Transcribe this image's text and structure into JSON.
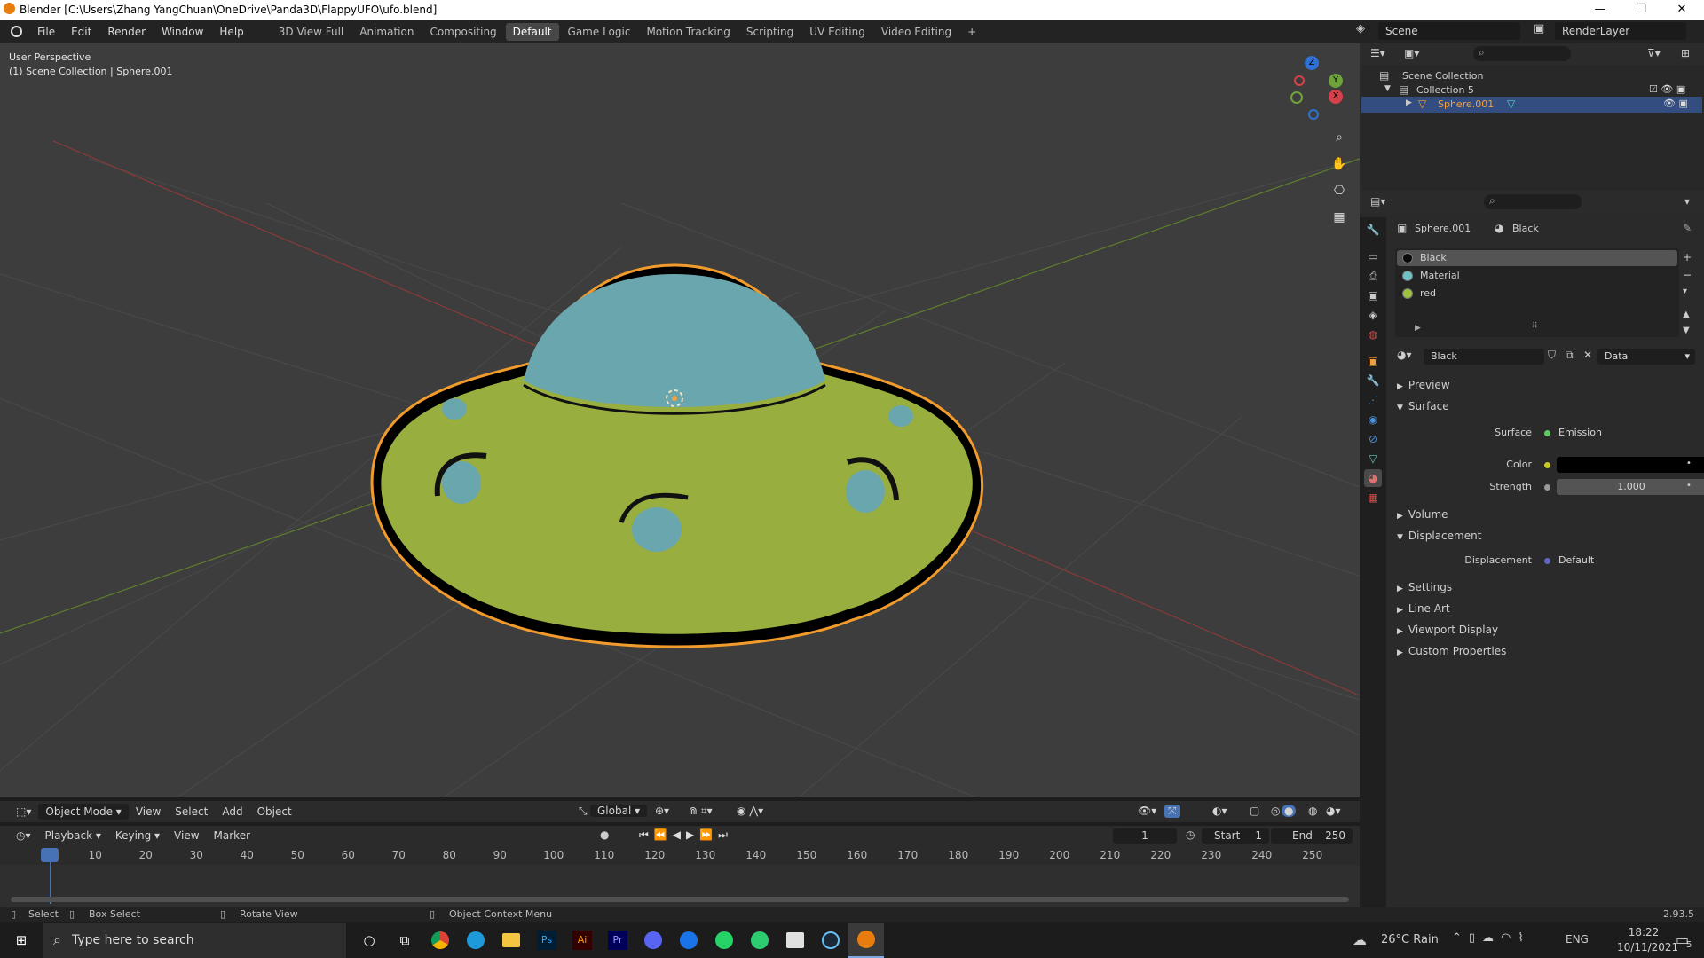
{
  "window": {
    "title": "Blender [C:\\Users\\Zhang YangChuan\\OneDrive\\Panda3D\\FlappyUFO\\ufo.blend]",
    "minimize": "—",
    "restore": "❐",
    "close": "✕"
  },
  "menu": [
    "File",
    "Edit",
    "Render",
    "Window",
    "Help"
  ],
  "workspaces": [
    "3D View Full",
    "Animation",
    "Compositing",
    "Default",
    "Game Logic",
    "Motion Tracking",
    "Scripting",
    "UV Editing",
    "Video Editing"
  ],
  "active_workspace": "Default",
  "add_workspace": "+",
  "scene": {
    "name": "Scene",
    "render_layer": "RenderLayer"
  },
  "viewport": {
    "perspective": "User Perspective",
    "collection_label": "(1) Scene Collection | Sphere.001",
    "gizmo": {
      "z": "Z",
      "y": "Y",
      "x": "X"
    },
    "header": {
      "mode": "Object Mode",
      "menus": [
        "View",
        "Select",
        "Add",
        "Object"
      ],
      "orientation": "Global"
    }
  },
  "timeline": {
    "menus": [
      "Playback",
      "Keying",
      "View",
      "Marker"
    ],
    "current_frame": "1",
    "start_label": "Start",
    "start": "1",
    "end_label": "End",
    "end": "250",
    "ruler": [
      "1",
      "10",
      "20",
      "30",
      "40",
      "50",
      "60",
      "70",
      "80",
      "90",
      "100",
      "110",
      "120",
      "130",
      "140",
      "150",
      "160",
      "170",
      "180",
      "190",
      "200",
      "210",
      "220",
      "230",
      "240",
      "250"
    ]
  },
  "outliner": {
    "root": "Scene Collection",
    "collection": "Collection 5",
    "object": "Sphere.001"
  },
  "properties": {
    "object": "Sphere.001",
    "material": "Black",
    "slots": [
      {
        "name": "Black",
        "color": "#0a0a0a"
      },
      {
        "name": "Material",
        "color": "#6fc3c7"
      },
      {
        "name": "red",
        "color": "#9bc43c"
      }
    ],
    "material_field": "Black",
    "link": "Data",
    "panels": {
      "preview": "Preview",
      "surface": "Surface",
      "surface_label": "Surface",
      "surface_value": "Emission",
      "color_label": "Color",
      "strength_label": "Strength",
      "strength_value": "1.000",
      "volume": "Volume",
      "displacement": "Displacement",
      "displacement_label": "Displacement",
      "displacement_value": "Default",
      "settings": "Settings",
      "line_art": "Line Art",
      "viewport_display": "Viewport Display",
      "custom_properties": "Custom Properties"
    }
  },
  "statusbar": {
    "select": "Select",
    "box_select": "Box Select",
    "rotate_view": "Rotate View",
    "context_menu": "Object Context Menu",
    "version": "2.93.5"
  },
  "taskbar": {
    "search_placeholder": "Type here to search",
    "weather": "26°C  Rain",
    "language": "ENG",
    "time": "18:22",
    "date": "10/11/2021",
    "notifications": "5",
    "apps": [
      "Ps",
      "Ai",
      "Pr"
    ]
  }
}
